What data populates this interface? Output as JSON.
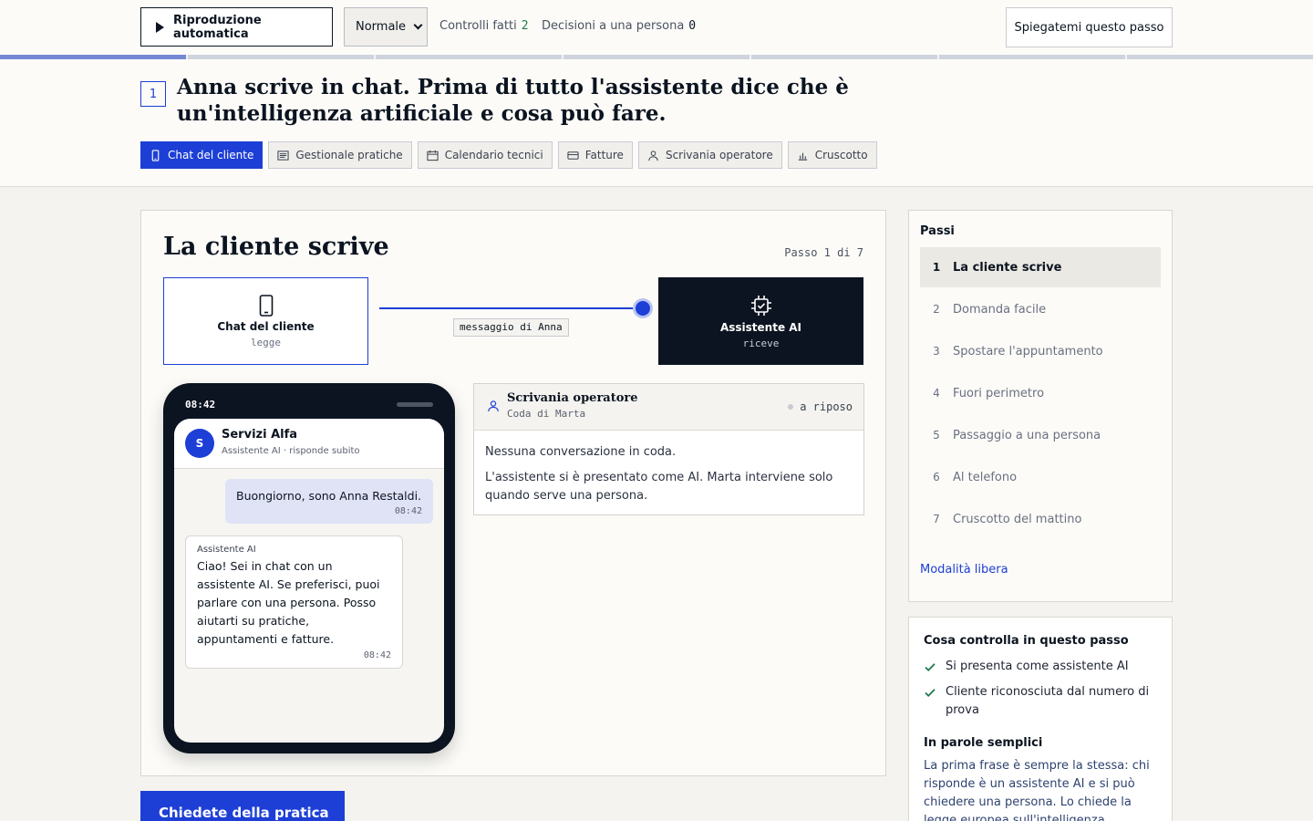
{
  "toolbar": {
    "autoplay_label": "Riproduzione automatica",
    "speed_value": "Normale",
    "checks_label": "Controlli fatti",
    "checks_count": "2",
    "decisions_label": "Decisioni a una persona",
    "decisions_count": "0",
    "explain_label": "Spiegatemi questo passo"
  },
  "progress": {
    "current_step": 1,
    "total_steps": 7
  },
  "header": {
    "step_number": "1",
    "title": "Anna scrive in chat. Prima di tutto l'assistente dice che è un'intelligenza artificiale e cosa può fare.",
    "apps": [
      {
        "label": "Chat del cliente",
        "icon": "phone-icon",
        "active": true
      },
      {
        "label": "Gestionale pratiche",
        "icon": "list-icon",
        "active": false
      },
      {
        "label": "Calendario tecnici",
        "icon": "calendar-icon",
        "active": false
      },
      {
        "label": "Fatture",
        "icon": "card-icon",
        "active": false
      },
      {
        "label": "Scrivania operatore",
        "icon": "person-icon",
        "active": false
      },
      {
        "label": "Cruscotto",
        "icon": "bar-chart-icon",
        "active": false
      }
    ]
  },
  "main": {
    "title": "La cliente scrive",
    "step_counter": "Passo 1 di 7",
    "flow": {
      "from_label": "Chat del cliente",
      "from_sub": "legge",
      "message_label": "messaggio di Anna",
      "to_label": "Assistente AI",
      "to_sub": "riceve"
    },
    "phone": {
      "time": "08:42",
      "contact_initial": "S",
      "contact_name": "Servizi Alfa",
      "contact_sub": "Assistente AI · risponde subito",
      "user_message": "Buongiorno, sono Anna Restaldi.",
      "user_time": "08:42",
      "ai_sender": "Assistente AI",
      "ai_message": "Ciao! Sei in chat con un assistente AI. Se preferisci, puoi parlare con una persona. Posso aiutarti su pratiche, appuntamenti e fatture.",
      "ai_time": "08:42"
    },
    "desk": {
      "title": "Scrivania operatore",
      "subtitle": "Coda di Marta",
      "status": "a riposo",
      "empty_text": "Nessuna conversazione in coda.",
      "note": "L'assistente si è presentato come AI. Marta interviene solo quando serve una persona."
    },
    "cta_label": "Chiedete della pratica →"
  },
  "steps": {
    "title": "Passi",
    "items": [
      {
        "n": "1",
        "label": "La cliente scrive",
        "active": true
      },
      {
        "n": "2",
        "label": "Domanda facile",
        "active": false
      },
      {
        "n": "3",
        "label": "Spostare l'appuntamento",
        "active": false
      },
      {
        "n": "4",
        "label": "Fuori perimetro",
        "active": false
      },
      {
        "n": "5",
        "label": "Passaggio a una persona",
        "active": false
      },
      {
        "n": "6",
        "label": "Al telefono",
        "active": false
      },
      {
        "n": "7",
        "label": "Cruscotto del mattino",
        "active": false
      }
    ],
    "free_mode_label": "Modalità libera"
  },
  "checks": {
    "title": "Cosa controlla in questo passo",
    "items": [
      "Si presenta come assistente AI",
      "Cliente riconosciuta dal numero di prova"
    ],
    "plain_title": "In parole semplici",
    "plain_text": "La prima frase è sempre la stessa: chi risponde è un assistente AI e si può chiedere una persona. Lo chiede la legge europea sull'intelligenza artificiale."
  },
  "colors": {
    "accent": "#1d3fd6",
    "dark": "#0b1420",
    "check_green": "#1f7a4a",
    "progress_done": "#7488d4"
  }
}
